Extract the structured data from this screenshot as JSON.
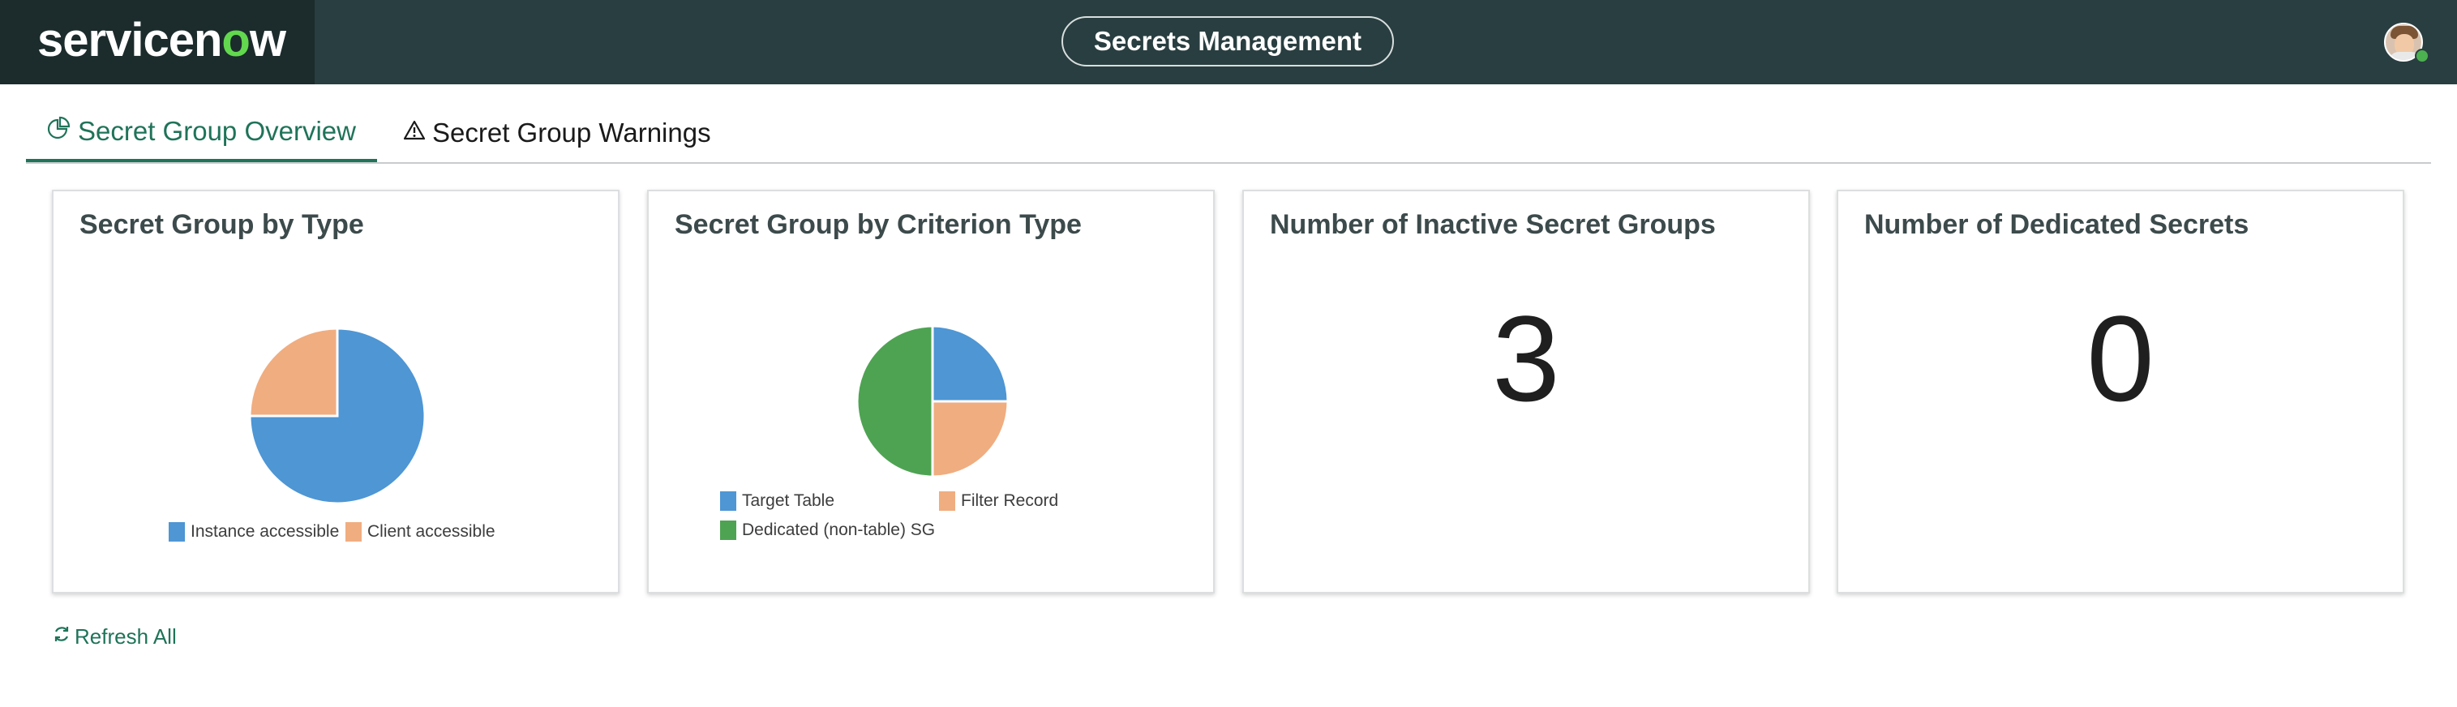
{
  "header": {
    "brand": {
      "part1": "servicen",
      "o": "o",
      "part2": "w"
    },
    "app_title": "Secrets Management",
    "avatar_icon": "user-avatar-icon",
    "presence_color": "#4caf50"
  },
  "tabs": [
    {
      "label": "Secret Group Overview",
      "icon": "pie-chart-icon",
      "active": true
    },
    {
      "label": "Secret Group Warnings",
      "icon": "warning-icon",
      "active": false
    }
  ],
  "cards": {
    "by_type": {
      "title": "Secret Group by Type",
      "legend": [
        "Instance accessible",
        "Client accessible"
      ]
    },
    "by_criterion": {
      "title": "Secret Group by Criterion Type",
      "legend": [
        "Target Table",
        "Filter Record",
        "Dedicated (non-table) SG"
      ]
    },
    "inactive": {
      "title": "Number of Inactive Secret Groups",
      "value": "3"
    },
    "dedicated": {
      "title": "Number of Dedicated Secrets",
      "value": "0"
    }
  },
  "colors": {
    "blue": "#4e96d4",
    "orange": "#f0ad80",
    "green": "#4ea352",
    "accent": "#1f7359",
    "header_bg": "#293e40"
  },
  "chart_data": [
    {
      "type": "pie",
      "categories": [
        "Instance accessible",
        "Client accessible"
      ],
      "values": [
        75,
        25
      ],
      "colors": [
        "#4e96d4",
        "#f0ad80"
      ],
      "title": "Secret Group by Type",
      "legend": "bottom"
    },
    {
      "type": "pie",
      "categories": [
        "Target Table",
        "Filter Record",
        "Dedicated (non-table) SG"
      ],
      "values": [
        25,
        25,
        50
      ],
      "colors": [
        "#4e96d4",
        "#f0ad80",
        "#4ea352"
      ],
      "title": "Secret Group by Criterion Type",
      "legend": "bottom"
    }
  ],
  "actions": {
    "refresh_label": "Refresh All",
    "refresh_icon": "refresh-icon"
  }
}
